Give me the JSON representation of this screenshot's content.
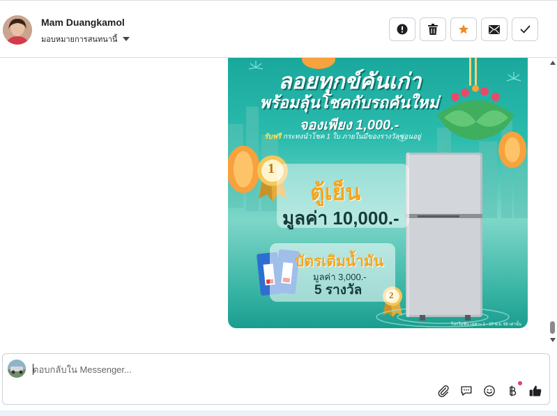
{
  "contact": {
    "name": "Mam Duangkamol",
    "assign_label": "มอบหมายการสนทนานี้"
  },
  "header_actions": [
    {
      "icon": "alert-icon",
      "label": "spam"
    },
    {
      "icon": "trash-icon",
      "label": "delete"
    },
    {
      "icon": "star-icon",
      "label": "follow up",
      "color": "#f28b1d"
    },
    {
      "icon": "envelope-icon",
      "label": "mark unread"
    },
    {
      "icon": "check-icon",
      "label": "done"
    }
  ],
  "promo": {
    "title_line1": "ลอยทุกข์คันเก่า",
    "title_line2": "พร้อมลุ้นโชคกับรถคันใหม่",
    "title_line3": "จองเพียง 1,000.-",
    "free_label": "รับฟรี",
    "free_text": "กระทงนำโชค 1 ใบ ภายในมีของรางวัลซ่อนอยู่",
    "prize1_rank": "1",
    "prize1_name": "ตู้เย็น",
    "prize1_value": "มูลค่า 10,000.-",
    "prize2_rank": "2",
    "prize2_name": "บัตรเติมน้ำมัน",
    "prize2_value": "มูลค่า 3,000.-",
    "prize2_count": "5 รางวัล",
    "footnote": "โปรโมชั่น เฉพาะ 1 - 10 พ.ย. 68 เท่านั้น"
  },
  "composer": {
    "placeholder": "ตอบกลับใน Messenger..."
  },
  "composer_tools": [
    {
      "icon": "paperclip-icon"
    },
    {
      "icon": "saved-reply-icon"
    },
    {
      "icon": "emoji-icon"
    },
    {
      "icon": "baht-payment-icon",
      "badge": true
    },
    {
      "icon": "thumbs-up-icon",
      "color": "#1c1e21"
    }
  ],
  "colors": {
    "accent_star": "#f28b1d",
    "border": "#ccd0d5",
    "promo_teal": "#1aa89c"
  }
}
